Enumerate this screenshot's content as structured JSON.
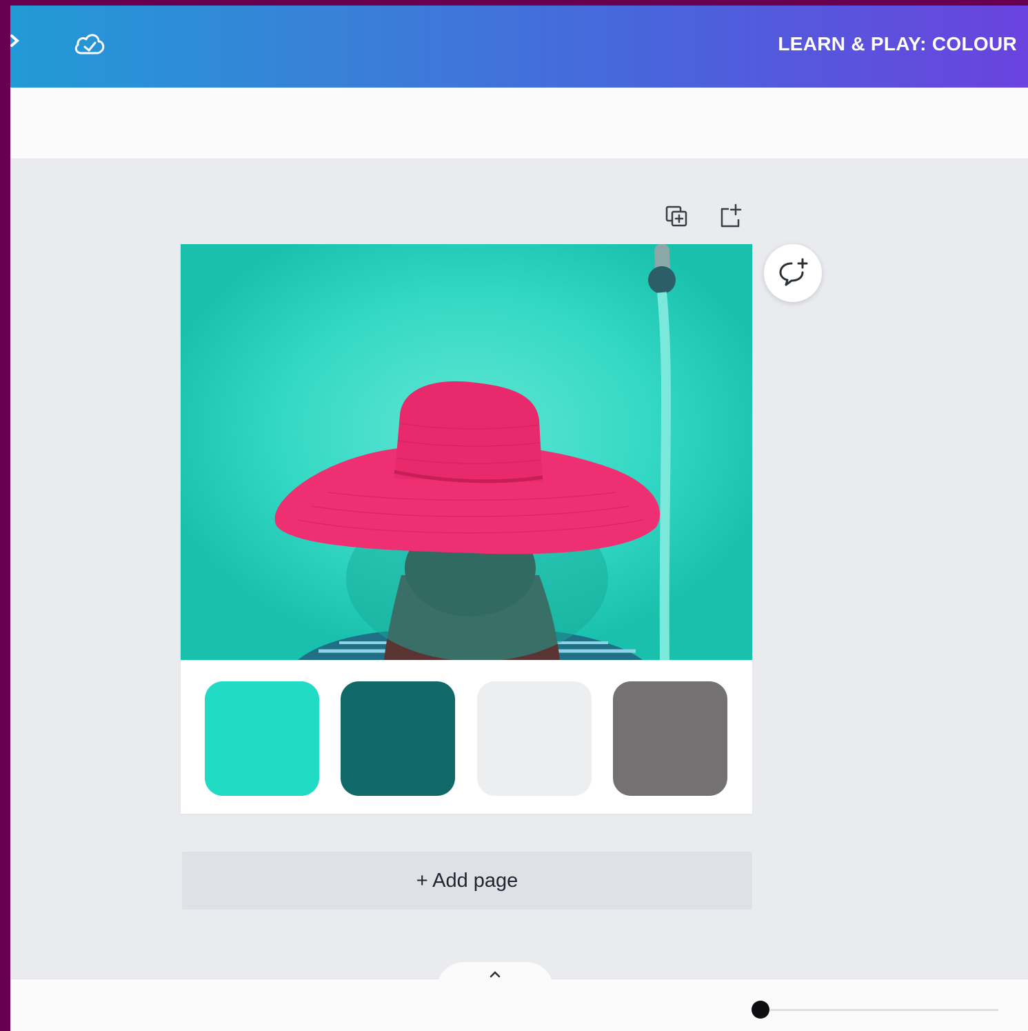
{
  "header": {
    "title": "LEARN & PLAY: COLOUR",
    "icons": [
      "back-chevron-icon",
      "cloud-saved-icon"
    ]
  },
  "page_actions": {
    "icons": [
      "duplicate-page-icon",
      "add-page-icon",
      "add-comment-icon"
    ]
  },
  "design": {
    "image": "Woman in a pink wide-brim hat against a turquoise wall",
    "palette": [
      "#22dbc5",
      "#106869",
      "#eceeef",
      "#747172"
    ]
  },
  "add_page": {
    "label": "+ Add page"
  },
  "footer": {
    "icons": [
      "chevron-up-icon"
    ],
    "zoom_level": 0
  },
  "colors": {
    "outer_background": "#68004f",
    "header_gradient_start": "#229ad6",
    "header_gradient_end": "#6a43de",
    "canvas_background": "#e9ebef"
  }
}
